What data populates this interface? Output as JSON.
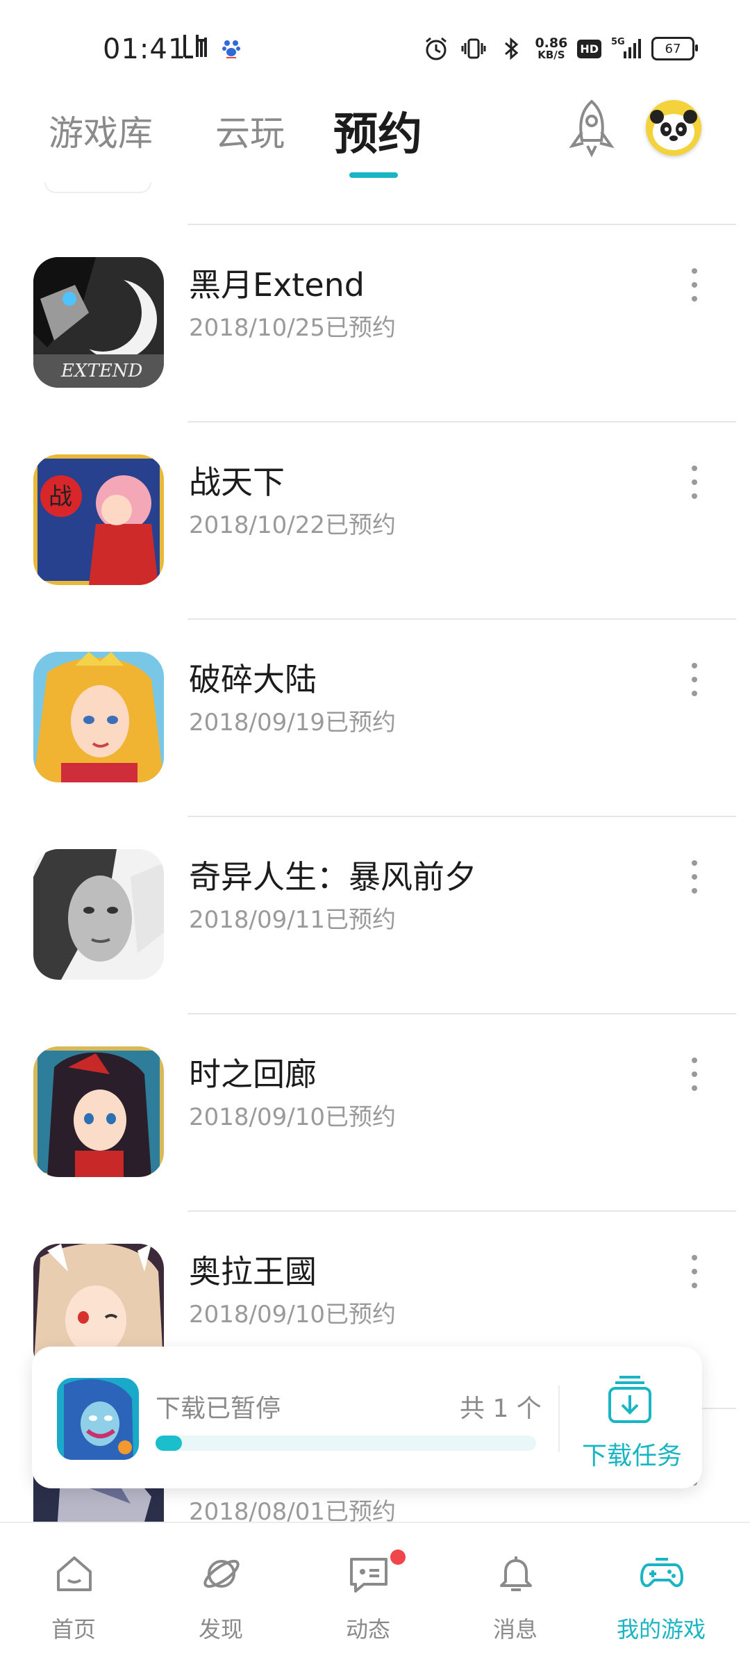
{
  "status_bar": {
    "time": "01:41",
    "app_glyph": "lt",
    "net_speed_value": "0.86",
    "net_speed_unit": "KB/S",
    "hd_label": "HD",
    "signal_label": "5G",
    "battery": "67"
  },
  "top_tabs": [
    {
      "label": "游戏库",
      "active": false
    },
    {
      "label": "云玩",
      "active": false
    },
    {
      "label": "预约",
      "active": true
    }
  ],
  "accent_color": "#19b5c4",
  "reservations": [
    {
      "title": "黑月Extend",
      "subtitle": "2018/10/25已预约",
      "icon": "game-thumb-heiyue"
    },
    {
      "title": "战天下",
      "subtitle": "2018/10/22已预约",
      "icon": "game-thumb-zhantianxia"
    },
    {
      "title": "破碎大陆",
      "subtitle": "2018/09/19已预约",
      "icon": "game-thumb-posuidalu"
    },
    {
      "title": "奇异人生：暴风前夕",
      "subtitle": "2018/09/11已预约",
      "icon": "game-thumb-qiyirensheng"
    },
    {
      "title": "时之回廊",
      "subtitle": "2018/09/10已预约",
      "icon": "game-thumb-shizhihuilang"
    },
    {
      "title": "奥拉王國",
      "subtitle": "2018/09/10已预约",
      "icon": "game-thumb-aolawangguo"
    },
    {
      "title": "",
      "subtitle": "2018/08/01已预约",
      "icon": "game-thumb-partial"
    }
  ],
  "download_card": {
    "status": "下载已暂停",
    "count": "共 1 个",
    "progress": 0.07,
    "task_label": "下载任务"
  },
  "bottom_nav": [
    {
      "label": "首页",
      "icon": "home-icon",
      "active": false
    },
    {
      "label": "发现",
      "icon": "planet-icon",
      "active": false
    },
    {
      "label": "动态",
      "icon": "chat-icon",
      "active": false,
      "badge": true
    },
    {
      "label": "消息",
      "icon": "bell-icon",
      "active": false
    },
    {
      "label": "我的游戏",
      "icon": "gamepad-icon",
      "active": true
    }
  ]
}
